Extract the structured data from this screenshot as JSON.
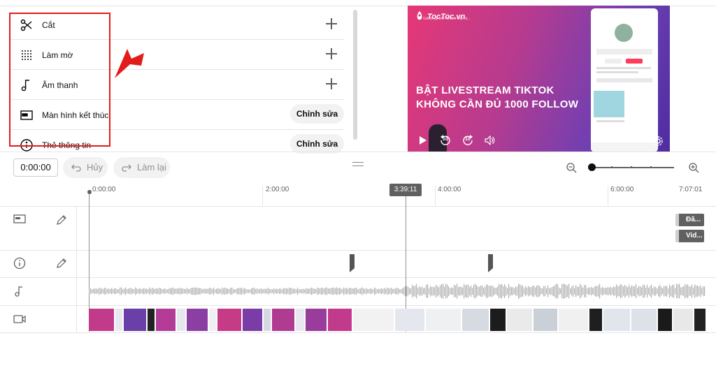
{
  "tools": [
    {
      "label": "Cắt",
      "icon": "scissors-icon",
      "action": "plus"
    },
    {
      "label": "Làm mờ",
      "icon": "blur-icon",
      "action": "plus"
    },
    {
      "label": "Âm thanh",
      "icon": "music-note-icon",
      "action": "plus"
    },
    {
      "label": "Màn hình kết thúc",
      "icon": "end-screen-icon",
      "action": "button",
      "button_label": "Chỉnh sửa"
    },
    {
      "label": "Thẻ thông tin",
      "icon": "info-card-icon",
      "action": "button",
      "button_label": "Chỉnh sửa"
    }
  ],
  "preview": {
    "logo": "TocToc.vn",
    "logo_sub": "Giải pháp kinh doanh tiếp thị...",
    "title_line1": "BẬT LIVESTREAM TIKTOK",
    "title_line2": "KHÔNG CẦN ĐỦ 1000 FOLLOW",
    "rewind_label": "10",
    "forward_label": "10"
  },
  "toolbar": {
    "current_time": "0:00:00",
    "undo_label": "Hủy",
    "redo_label": "Làm lại",
    "zoom_level": 0.0
  },
  "timeline": {
    "ruler": [
      "0:00:00",
      "2:00:00",
      "4:00:00",
      "6:00:00",
      "7:07:01"
    ],
    "playhead_time": "3:39:11",
    "end_screen_chips": [
      "Đă...",
      "Vid..."
    ],
    "colors": {
      "accent_red": "#e21b1b",
      "playhead": "#606060",
      "preview_pink": "#e63876",
      "preview_purple": "#4e2ca0"
    }
  }
}
